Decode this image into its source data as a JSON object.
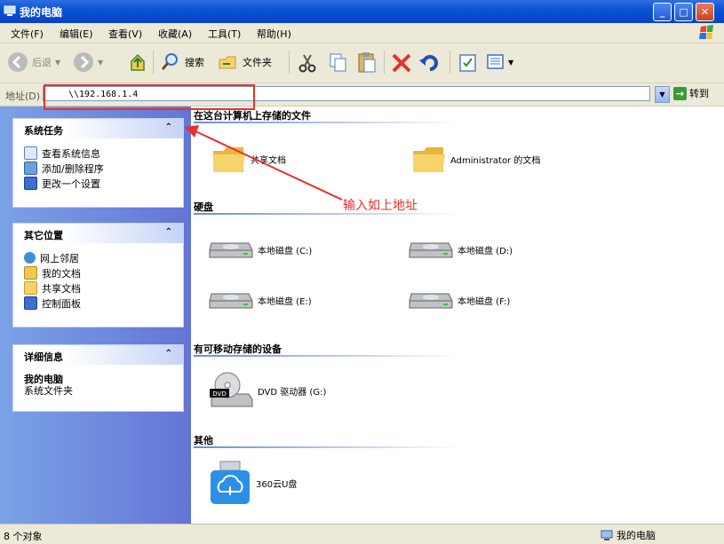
{
  "window": {
    "title": "我的电脑"
  },
  "menu": [
    "文件(F)",
    "编辑(E)",
    "查看(V)",
    "收藏(A)",
    "工具(T)",
    "帮助(H)"
  ],
  "toolbar": {
    "back": "后退",
    "search": "搜索",
    "folders": "文件夹"
  },
  "address": {
    "label": "地址(D)",
    "value": "\\\\192.168.1.4",
    "go": "转到"
  },
  "left": {
    "system_tasks": {
      "title": "系统任务",
      "items": [
        "查看系统信息",
        "添加/删除程序",
        "更改一个设置"
      ]
    },
    "other_places": {
      "title": "其它位置",
      "items": [
        "网上邻居",
        "我的文档",
        "共享文档",
        "控制面板"
      ]
    },
    "details": {
      "title": "详细信息",
      "name": "我的电脑",
      "type": "系统文件夹"
    }
  },
  "sections": {
    "files": {
      "title": "在这台计算机上存储的文件",
      "items": [
        "共享文档",
        "Administrator 的文档"
      ]
    },
    "drives": {
      "title": "硬盘",
      "items": [
        "本地磁盘 (C:)",
        "本地磁盘 (D:)",
        "本地磁盘 (E:)",
        "本地磁盘 (F:)"
      ]
    },
    "removable": {
      "title": "有可移动存储的设备",
      "items": [
        "DVD 驱动器 (G:)"
      ]
    },
    "other": {
      "title": "其他",
      "items": [
        "360云U盘"
      ]
    }
  },
  "status": {
    "count": "8 个对象",
    "location": "我的电脑"
  },
  "annotation": {
    "text": "输入如上地址"
  },
  "dvd_badge": "DVD",
  "colors": {
    "accent": "#0a53d6",
    "annotation_red": "#e8302a"
  }
}
